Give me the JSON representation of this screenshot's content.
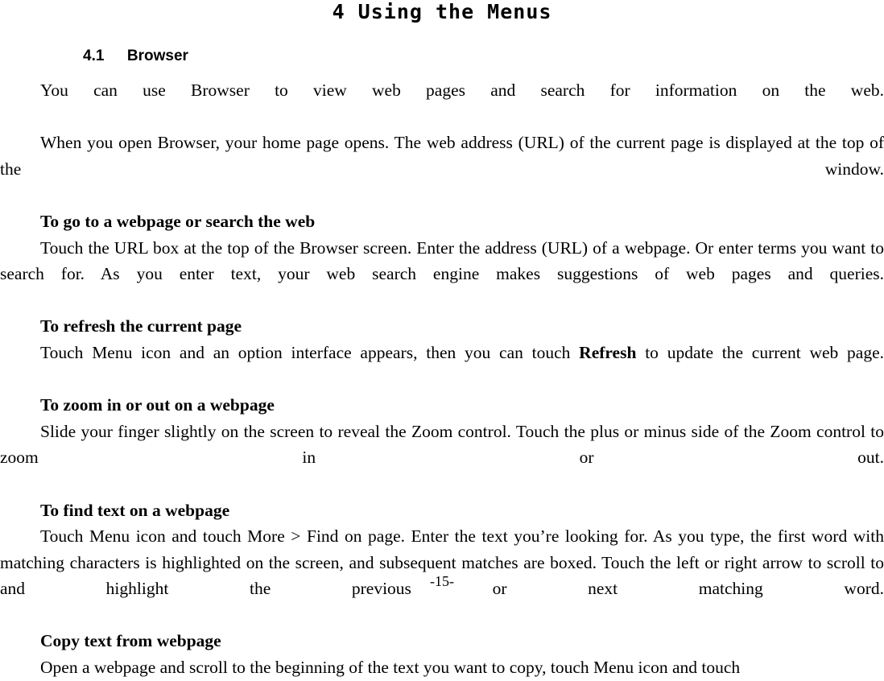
{
  "document": {
    "chapter_title": "4 Using the Menus",
    "section": {
      "number": "4.1",
      "title": "Browser",
      "heading_text": "4.1  Browser"
    },
    "page_number": "-15-"
  },
  "content": {
    "intro_para_1": "You can use Browser to view web pages and search for information on the web.",
    "intro_para_2": "When you open Browser, your home page opens. The web address (URL) of the current page is displayed at the top of the window.",
    "blocks": [
      {
        "id": "goto-webpage",
        "subheading": "To go to a webpage or search the web",
        "paragraph": "Touch the URL box at the top of the Browser screen. Enter the address (URL) of a webpage. Or enter terms you want to search for. As you enter text, your web search engine makes suggestions of web pages and queries."
      },
      {
        "id": "refresh-page",
        "subheading": "To refresh the current page",
        "paragraph_before_bold": "Touch Menu icon and an option interface appears, then you can touch ",
        "bold_word": "Refresh",
        "paragraph_after_bold": " to update the current web page."
      },
      {
        "id": "zoom-webpage",
        "subheading": "To zoom in or out on a webpage",
        "paragraph": "Slide your finger slightly on the screen to reveal the Zoom control. Touch the plus or minus side of the Zoom control to zoom in or out."
      },
      {
        "id": "find-text",
        "subheading": "To find text on a webpage",
        "paragraph": "Touch Menu icon and touch More > Find on page. Enter the text you’re looking for. As you type, the first word with matching characters is highlighted on the screen, and subsequent matches are boxed. Touch the left or right arrow to scroll to and highlight the previous or next matching word."
      },
      {
        "id": "copy-text",
        "subheading": "Copy text from webpage",
        "paragraph": "Open a webpage and scroll to the beginning of the text you want to copy, touch Menu icon and touch"
      }
    ]
  }
}
